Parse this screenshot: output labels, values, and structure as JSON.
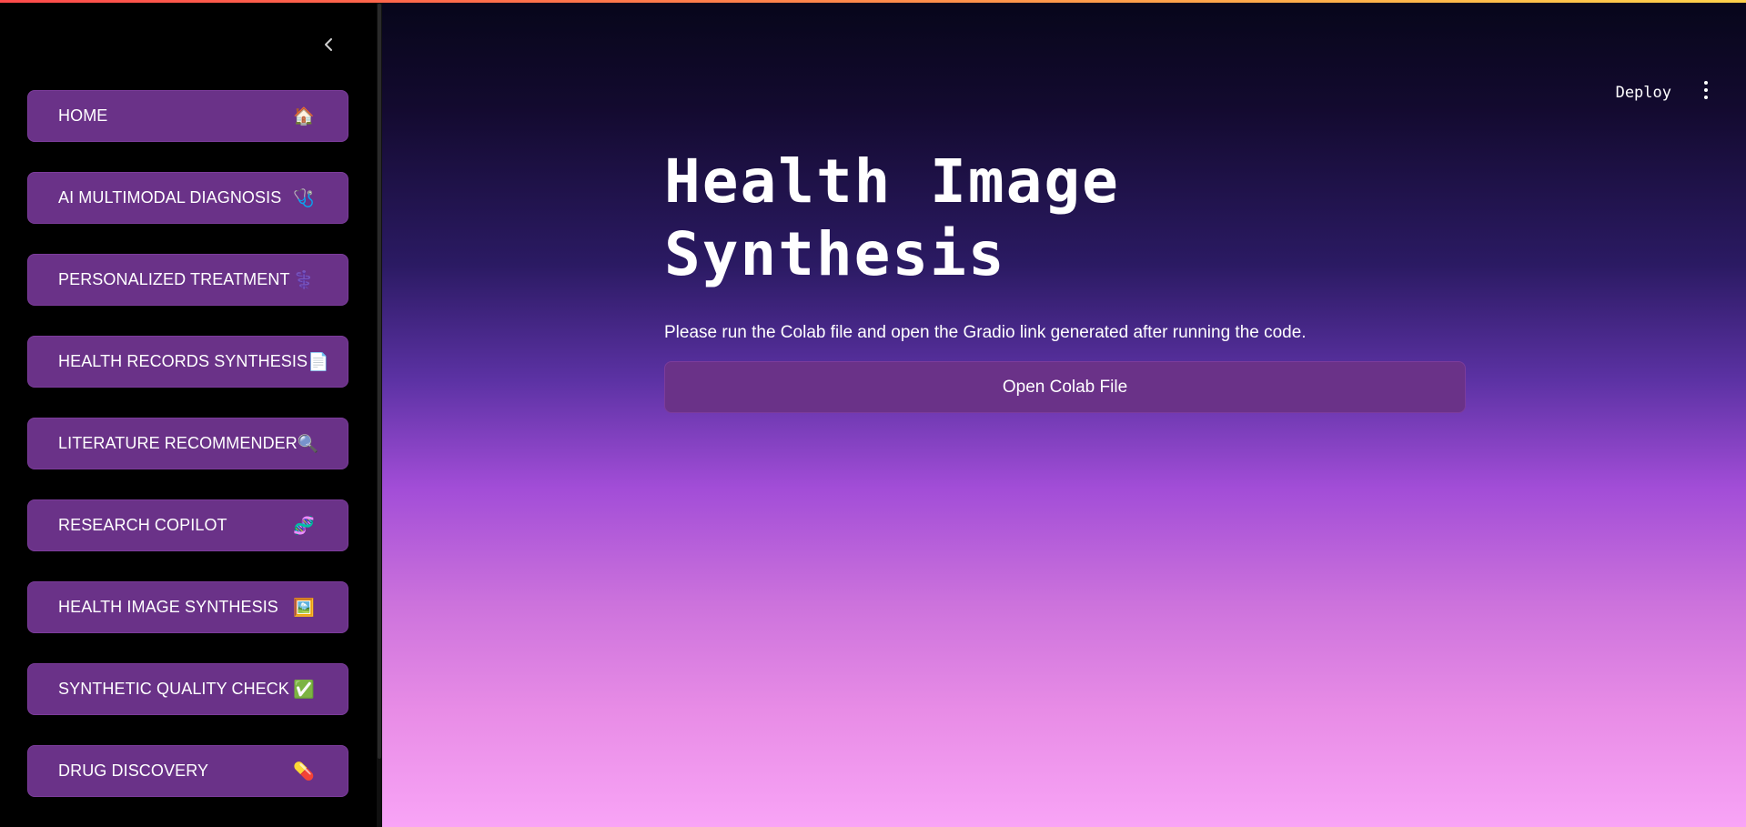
{
  "sidebar": {
    "collapse_icon": "chevron-left-icon",
    "items": [
      {
        "label": "HOME",
        "emoji": "🏠"
      },
      {
        "label": "AI MULTIMODAL DIAGNOSIS",
        "emoji": "🩺"
      },
      {
        "label": "PERSONALIZED TREATMENT",
        "emoji": "⚕️"
      },
      {
        "label": "HEALTH RECORDS SYNTHESIS",
        "emoji": "📄"
      },
      {
        "label": "LITERATURE RECOMMENDER",
        "emoji": "🔍"
      },
      {
        "label": "RESEARCH COPILOT",
        "emoji": "🧬"
      },
      {
        "label": "HEALTH IMAGE SYNTHESIS",
        "emoji": "🖼️"
      },
      {
        "label": "SYNTHETIC QUALITY CHECK",
        "emoji": "✅"
      },
      {
        "label": "DRUG DISCOVERY",
        "emoji": "💊"
      }
    ]
  },
  "header": {
    "deploy_label": "Deploy",
    "menu_icon": "kebab-menu-icon"
  },
  "main": {
    "title": "Health Image Synthesis",
    "description": "Please run the Colab file and open the Gradio link generated after running the code.",
    "button_label": "Open Colab File"
  },
  "colors": {
    "sidebar_bg": "#000000",
    "button_bg": "#6a3288",
    "gradient_top": "#07061a",
    "gradient_bottom": "#f8a4f6",
    "text": "#ffffff"
  }
}
